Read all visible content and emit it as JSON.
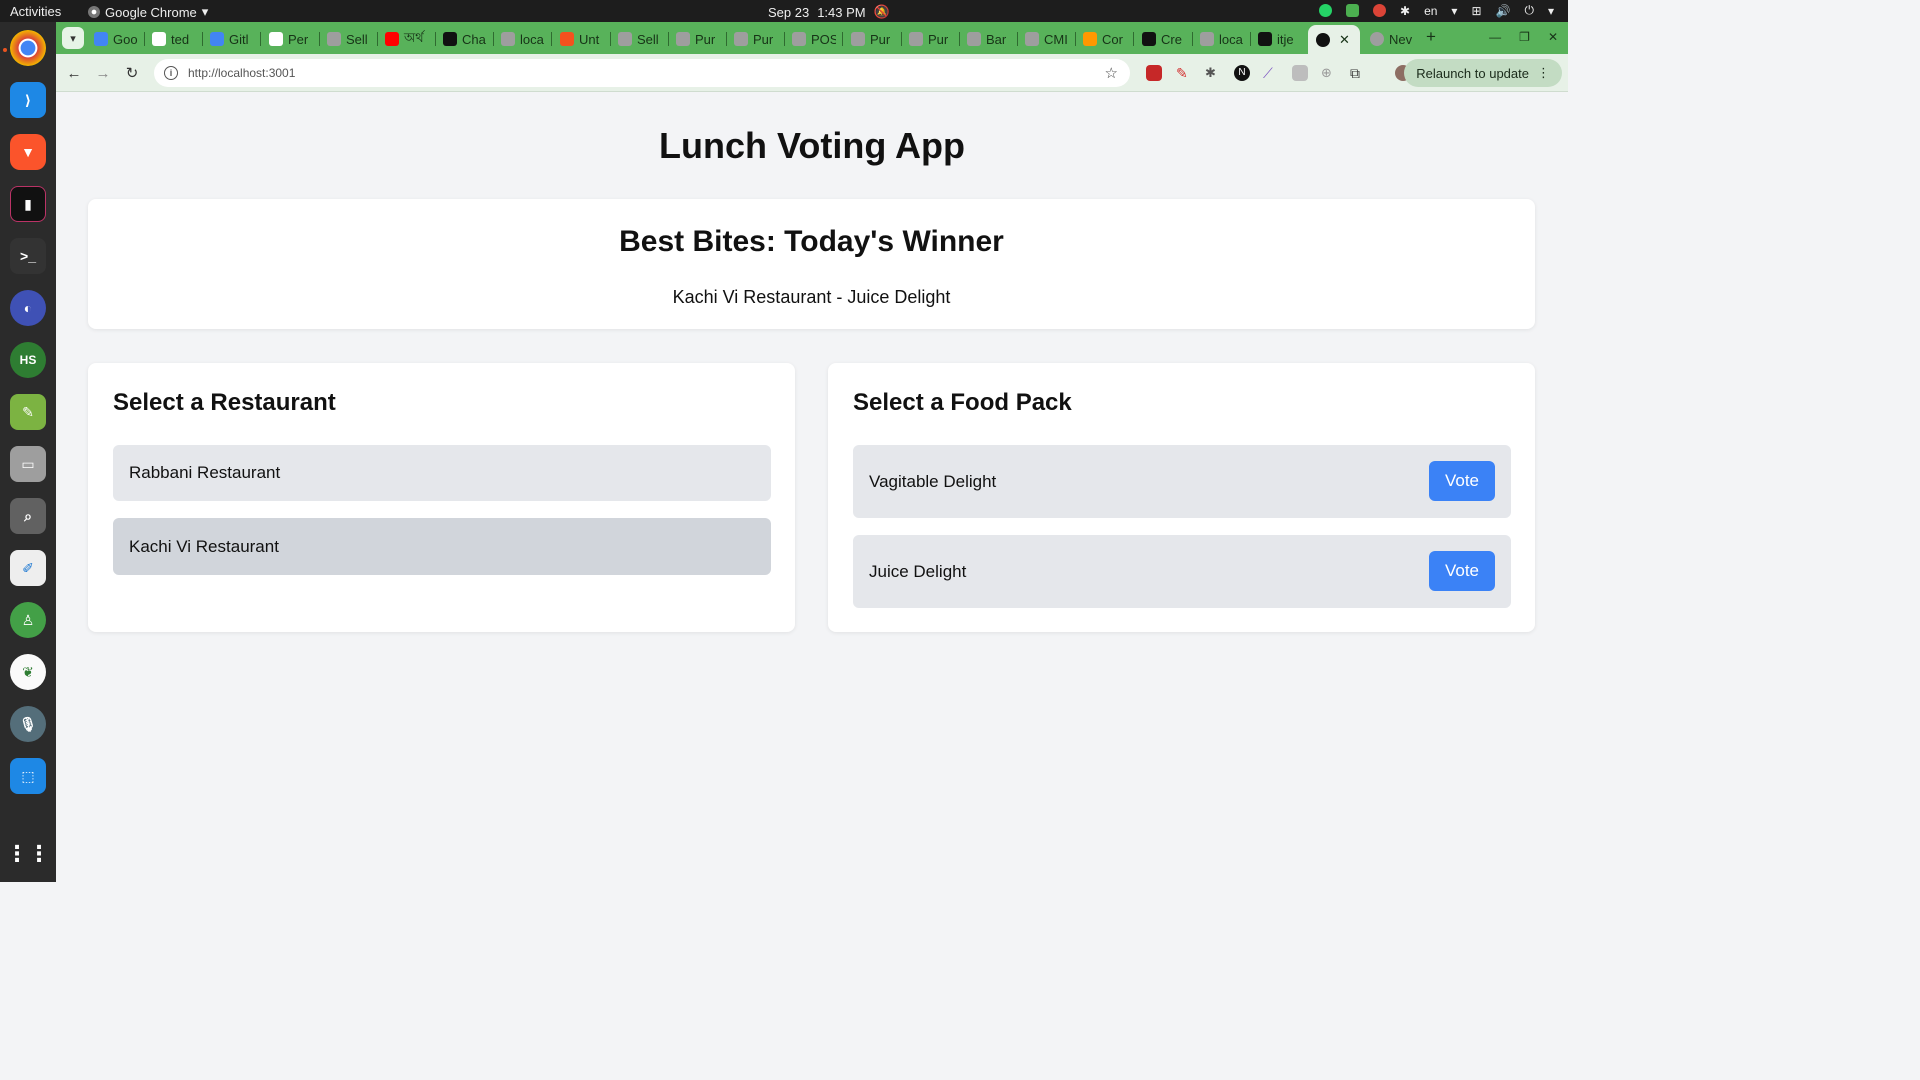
{
  "os": {
    "activities": "Activities",
    "app_name": "Google Chrome",
    "clock_date": "Sep 23",
    "clock_time": "1:43 PM",
    "lang": "en"
  },
  "browser": {
    "tabs": [
      {
        "label": "Goo",
        "color": "#4285f4"
      },
      {
        "label": "ted",
        "color": "#ffffff"
      },
      {
        "label": "Gitl",
        "color": "#4285f4"
      },
      {
        "label": "Per",
        "color": "#ffffff"
      },
      {
        "label": "Sell",
        "color": "#9e9e9e"
      },
      {
        "label": "অর্থ",
        "color": "#ff0000"
      },
      {
        "label": "Cha",
        "color": "#111111"
      },
      {
        "label": "loca",
        "color": "#9e9e9e"
      },
      {
        "label": "Unt",
        "color": "#f4511e"
      },
      {
        "label": "Sell",
        "color": "#9e9e9e"
      },
      {
        "label": "Pur",
        "color": "#9e9e9e"
      },
      {
        "label": "Pur",
        "color": "#9e9e9e"
      },
      {
        "label": "POS",
        "color": "#9e9e9e"
      },
      {
        "label": "Pur",
        "color": "#9e9e9e"
      },
      {
        "label": "Pur",
        "color": "#9e9e9e"
      },
      {
        "label": "Bar",
        "color": "#9e9e9e"
      },
      {
        "label": "CMI",
        "color": "#9e9e9e"
      },
      {
        "label": "Cor",
        "color": "#ff9800"
      },
      {
        "label": "Cre",
        "color": "#111111"
      },
      {
        "label": "loca",
        "color": "#9e9e9e"
      },
      {
        "label": "itje",
        "color": "#111111"
      }
    ],
    "active_tab_label": "",
    "new_tab_label": "Nev",
    "url": "http://localhost:3001",
    "relaunch_label": "Relaunch to update"
  },
  "app": {
    "title": "Lunch Voting App",
    "winner": {
      "heading": "Best Bites: Today's Winner",
      "text": "Kachi Vi Restaurant - Juice Delight"
    },
    "restaurants": {
      "heading": "Select a Restaurant",
      "items": [
        {
          "name": "Rabbani Restaurant",
          "selected": false
        },
        {
          "name": "Kachi Vi Restaurant",
          "selected": true
        }
      ]
    },
    "food_packs": {
      "heading": "Select a Food Pack",
      "vote_label": "Vote",
      "items": [
        {
          "name": "Vagitable Delight"
        },
        {
          "name": "Juice Delight"
        }
      ]
    }
  },
  "colors": {
    "accent": "#3b82f6",
    "tabstrip": "#58b25a"
  }
}
